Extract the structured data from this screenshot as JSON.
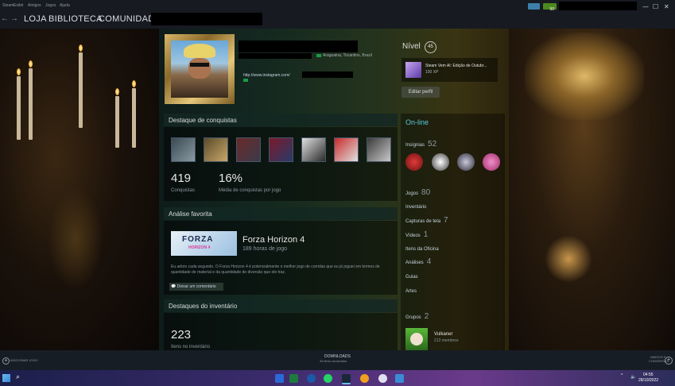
{
  "menu": {
    "items": [
      "Steam",
      "Exibir",
      "Amigos",
      "Jogos",
      "Ajuda"
    ]
  },
  "nav": {
    "back_glyph": "←",
    "forward_glyph": "→",
    "tabs": [
      "LOJA",
      "BIBLIOTECA",
      "COMUNIDADE"
    ]
  },
  "window": {
    "minimize": "—",
    "maximize": "☐",
    "close": "✕",
    "notif_count": "50"
  },
  "profile": {
    "location": "Araguaina, Tocantins, Brazil",
    "link": "http://www.instagram.com/",
    "level_label": "Nível",
    "level_value": "45",
    "event_badge": {
      "title": "Steam Vem Aí: Edição de Outubr...",
      "xp": "100 XP"
    },
    "edit_button": "Editar perfil"
  },
  "achievements": {
    "header": "Destaque de conquistas",
    "count": "419",
    "count_label": "Conquistas",
    "avg": "16%",
    "avg_label": "Média de conquistas por jogo"
  },
  "review": {
    "header": "Análise favorita",
    "game_title": "Forza Horizon 4",
    "hours": "189 horas de jogo",
    "logo_text": "FORZA",
    "logo_sub": "HORIZON 4",
    "body": "Eu adoro cada segundo. O Forza Horizon 4 é potencialmente o melhor jogo de corridas que eu já joguei em termos de quantidade de material e da quantidade de diversão que ele traz.",
    "comment_button": "Deixar um comentário"
  },
  "inventory": {
    "header": "Destaques do inventário",
    "count": "223",
    "label": "Itens no inventário"
  },
  "sidebar": {
    "status": "On-line",
    "badges_label": "Insígnias",
    "badges_count": "52",
    "games_label": "Jogos",
    "games_count": "80",
    "inventory_label": "Inventário",
    "screenshots_label": "Capturas de tela",
    "screenshots_count": "7",
    "videos_label": "Vídeos",
    "videos_count": "1",
    "workshop_label": "Itens da Oficina",
    "reviews_label": "Análises",
    "reviews_count": "4",
    "guides_label": "Guias",
    "artwork_label": "Artes",
    "groups_label": "Grupos",
    "groups_count": "2",
    "group_name": "Vulkaner",
    "group_members": "213 membros"
  },
  "bottom": {
    "add_game": "ADICIONAR JOGO",
    "downloads": "DOWNLOADS",
    "downloads_sub": "33 itens concluídos",
    "friends": "AMIGOS E",
    "friends2": "CONVERSAS"
  },
  "taskbar": {
    "time": "04:55",
    "date": "28/10/2022"
  },
  "colors": {
    "accent": "#66c0f4",
    "online": "#57cbde",
    "green": "#4c6b22",
    "bg": "#171a21"
  }
}
